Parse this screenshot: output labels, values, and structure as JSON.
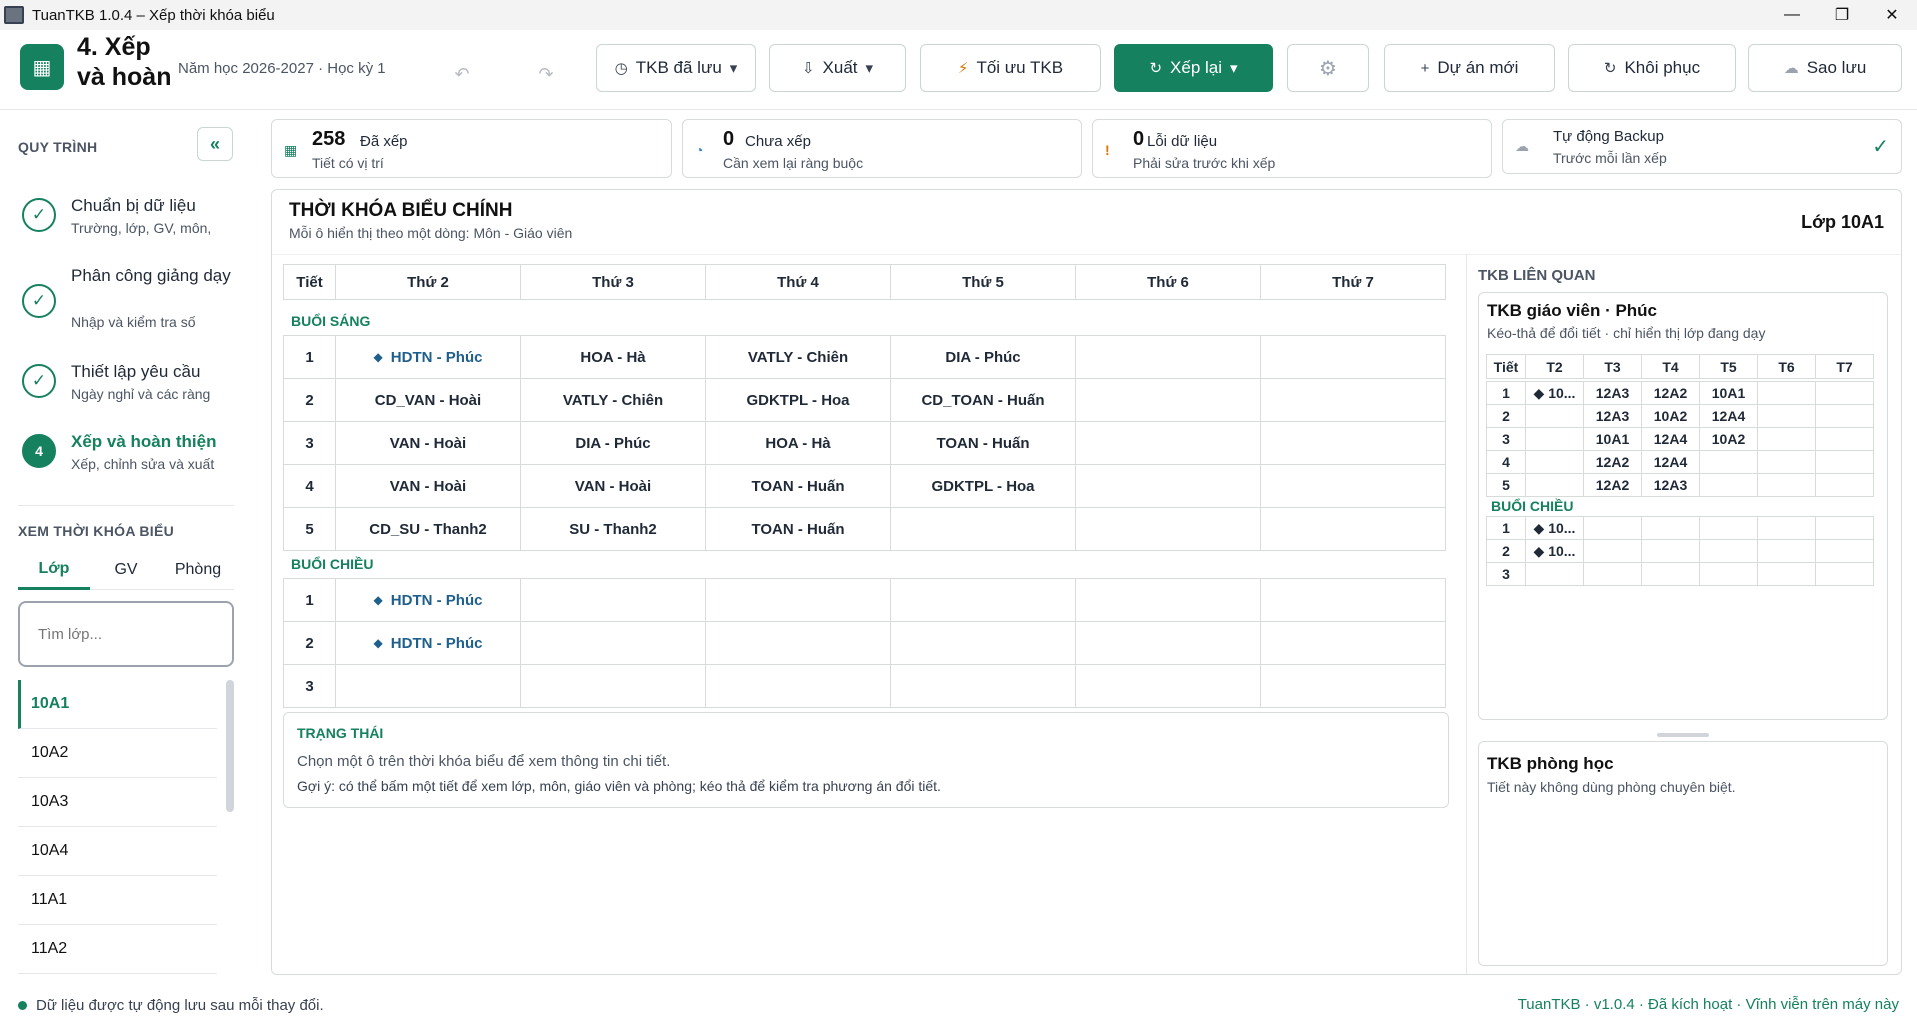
{
  "window": {
    "title": "TuanTKB 1.0.4 – Xếp thời khóa biểu",
    "minimize": "—",
    "maximize": "❐",
    "close": "✕"
  },
  "header": {
    "page_title": "4. Xếp và hoàn",
    "year_info": "Năm học 2026-2027  ·  Học kỳ 1",
    "undo_icon": "↶",
    "redo_icon": "↷",
    "buttons": {
      "saved": "TKB đã lưu",
      "export": "Xuất",
      "optimize": "Tối ưu TKB",
      "rearrange": "Xếp lại",
      "new_project": "Dự án mới",
      "restore": "Khôi phục",
      "backup": "Sao lưu"
    },
    "icons": {
      "clock": "◷",
      "export": "⇩",
      "bolt": "⚡",
      "refresh": "↻",
      "gear": "⚙",
      "plus": "+",
      "cloud": "☁",
      "caret": "▾"
    }
  },
  "sidebar": {
    "process_title": "QUY TRÌNH",
    "collapse_label": "«",
    "steps": [
      {
        "marker": "✓",
        "title": "Chuẩn bị dữ liệu",
        "subtitle": "Trường, lớp, GV, môn,"
      },
      {
        "marker": "✓",
        "title": "Phân công giảng dạy",
        "subtitle": "Nhập và kiểm tra số"
      },
      {
        "marker": "✓",
        "title": "Thiết lập yêu cầu",
        "subtitle": "Ngày nghỉ và các ràng"
      },
      {
        "marker": "4",
        "title": "Xếp và hoàn thiện",
        "subtitle": "Xếp, chỉnh sửa và xuất"
      }
    ],
    "view_title": "XEM THỜI KHÓA BIỂU",
    "view_tabs": [
      "Lớp",
      "GV",
      "Phòng"
    ],
    "search_placeholder": "Tìm lớp...",
    "classes": [
      "10A1",
      "10A2",
      "10A3",
      "10A4",
      "11A1",
      "11A2"
    ]
  },
  "stats": {
    "scheduled": {
      "value": "258",
      "label": "Đã xếp",
      "sub": "Tiết có vị trí"
    },
    "unscheduled": {
      "value": "0",
      "label": "Chưa xếp",
      "sub": "Cần xem lại ràng buộc"
    },
    "errors": {
      "value": "0",
      "label": "Lỗi dữ liệu",
      "sub": "Phải sửa trước khi xếp"
    },
    "backup": {
      "label": "Tự động Backup",
      "sub": "Trước mỗi lần xếp",
      "check": "✓"
    }
  },
  "main": {
    "title": "THỜI KHÓA BIỂU CHÍNH",
    "subtitle": "Mỗi ô hiển thị theo một dòng: Môn - Giáo viên",
    "class_label": "Lớp 10A1",
    "headers": [
      "Tiết",
      "Thứ 2",
      "Thứ 3",
      "Thứ 4",
      "Thứ 5",
      "Thứ 6",
      "Thứ 7"
    ],
    "morning_label": "BUỔI SÁNG",
    "afternoon_label": "BUỔI CHIỀU",
    "morning": [
      {
        "p": "1",
        "c": [
          "HDTN - Phúc",
          "HOA - Hà",
          "VATLY - Chiên",
          "DIA - Phúc",
          "",
          ""
        ]
      },
      {
        "p": "2",
        "c": [
          "CD_VAN - Hoài",
          "VATLY - Chiên",
          "GDKTPL - Hoa",
          "CD_TOAN - Huấn",
          "",
          ""
        ]
      },
      {
        "p": "3",
        "c": [
          "VAN - Hoài",
          "DIA - Phúc",
          "HOA - Hà",
          "TOAN - Huấn",
          "",
          ""
        ]
      },
      {
        "p": "4",
        "c": [
          "VAN - Hoài",
          "VAN - Hoài",
          "TOAN - Huấn",
          "GDKTPL - Hoa",
          "",
          ""
        ]
      },
      {
        "p": "5",
        "c": [
          "CD_SU - Thanh2",
          "SU - Thanh2",
          "TOAN - Huấn",
          "",
          "",
          ""
        ]
      }
    ],
    "afternoon": [
      {
        "p": "1",
        "c": [
          "HDTN - Phúc",
          "",
          "",
          "",
          "",
          ""
        ]
      },
      {
        "p": "2",
        "c": [
          "HDTN - Phúc",
          "",
          "",
          "",
          "",
          ""
        ]
      },
      {
        "p": "3",
        "c": [
          "",
          "",
          "",
          "",
          "",
          ""
        ]
      }
    ],
    "status": {
      "title": "TRẠNG THÁI",
      "text": "Chọn một ô trên thời khóa biểu để xem thông tin chi tiết.",
      "hint": "Gợi ý: có thể bấm một tiết để xem lớp, môn, giáo viên và phòng; kéo thả để kiểm tra phương án đổi tiết."
    }
  },
  "related": {
    "title": "TKB LIÊN QUAN",
    "teacher": {
      "title": "TKB giáo viên · Phúc",
      "subtitle": "Kéo-thả để đổi tiết · chỉ hiển thị lớp đang dạy",
      "headers": [
        "Tiết",
        "T2",
        "T3",
        "T4",
        "T5",
        "T6",
        "T7"
      ],
      "morning": [
        {
          "p": "1",
          "c": [
            "◆ 10...",
            "12A3",
            "12A2",
            "10A1",
            "",
            ""
          ]
        },
        {
          "p": "2",
          "c": [
            "",
            "12A3",
            "10A2",
            "12A4",
            "",
            ""
          ]
        },
        {
          "p": "3",
          "c": [
            "",
            "10A1",
            "12A4",
            "10A2",
            "",
            ""
          ]
        },
        {
          "p": "4",
          "c": [
            "",
            "12A2",
            "12A4",
            "",
            "",
            ""
          ]
        },
        {
          "p": "5",
          "c": [
            "",
            "12A2",
            "12A3",
            "",
            "",
            ""
          ]
        }
      ],
      "afternoon_label": "BUỔI CHIỀU",
      "afternoon": [
        {
          "p": "1",
          "c": [
            "◆ 10...",
            "",
            "",
            "",
            "",
            ""
          ]
        },
        {
          "p": "2",
          "c": [
            "◆ 10...",
            "",
            "",
            "",
            "",
            ""
          ]
        },
        {
          "p": "3",
          "c": [
            "",
            "",
            "",
            "",
            "",
            ""
          ]
        }
      ]
    },
    "room": {
      "title": "TKB phòng học",
      "text": "Tiết này không dùng phòng chuyên biệt."
    }
  },
  "footer": {
    "left": "Dữ liệu được tự động lưu sau mỗi thay đổi.",
    "right": "TuanTKB  ·  v1.0.4  ·  Đã kích hoạt  ·  Vĩnh viễn trên máy này"
  },
  "colors": {
    "accent": "#15815e",
    "special": "#1e5f8c",
    "warning": "#d97706",
    "info": "#3b82c4"
  }
}
